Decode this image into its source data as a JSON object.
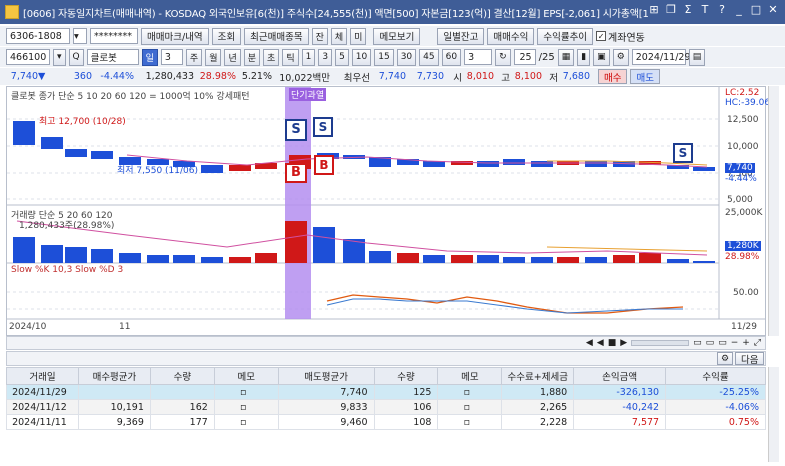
{
  "window": {
    "title": "[0606] 자동일지차트(매매내역) - KOSDAQ 외국인보유[6(천)] 주식수[24,555(천)] 액면[500] 자본금[123(억)] 결산[12월] EPS[-2,061] 시가총액[1"
  },
  "toolbar1": {
    "account": "6306-1808",
    "password": "********",
    "btn_trade_mark": "매매마크/내역",
    "btn_query": "조회",
    "btn_recent": "최근매매종목",
    "btn_jan": "잔",
    "btn_che": "체",
    "btn_mi": "미",
    "btn_memo": "메모보기",
    "btn_daily": "일별잔고",
    "btn_profit": "매매수익",
    "btn_trend": "수익률추이",
    "chk_link": "계좌연동"
  },
  "toolbar2": {
    "code": "466100",
    "name": "클로봇",
    "periods": [
      "일",
      "3",
      "주",
      "월",
      "년",
      "분",
      "초",
      "틱"
    ],
    "intervals": [
      "1",
      "3",
      "5",
      "10",
      "15",
      "30",
      "45",
      "60"
    ],
    "count_sel": "3",
    "page": "25",
    "total": "/25",
    "date": "2024/11/29"
  },
  "quote": {
    "price": "7,740",
    "arrow": "▼",
    "change": "360",
    "rate": "-4.44%",
    "volume": "1,280,433",
    "vol_rate": "28.98%",
    "turnover": "5.21%",
    "amount": "10,022백만",
    "priority": "최우선",
    "ask": "7,740",
    "bid": "7,730",
    "open_lbl": "시",
    "open": "8,010",
    "high_lbl": "고",
    "high": "8,100",
    "low_lbl": "저",
    "low": "7,680",
    "buy_btn": "매수",
    "sell_btn": "매도"
  },
  "chart": {
    "legend": "클로봇 종가 단순 5 10 20 60 120 = 1000억 10% 강세패턴",
    "highlight_label": "단기과열",
    "high_note": "최고 12,700 (10/28)",
    "low_note": "최저 7,550 (11/06)",
    "price_axis": [
      "12,500",
      "10,000",
      "7,500",
      "5,000"
    ],
    "lc": "LC:2.52",
    "hc": "HC:-39.06",
    "cur_price": "7,740",
    "cur_rate": "-4.44%",
    "vol_legend": "거래량 단순 5 20 60 120",
    "vol_value": "1,280,433주(28.98%)",
    "vol_axis": "25,000K",
    "vol_cur": "1,280K",
    "vol_rate": "28.98%",
    "slow_legend": "Slow %K 10,3 Slow %D 3",
    "slow_axis": "50.00",
    "date_left": "2024/10",
    "date_mid": "11",
    "date_right": "11/29",
    "marker_s": "S",
    "marker_b": "B"
  },
  "grid_btn": {
    "next": "다음"
  },
  "table": {
    "headers": [
      "거래일",
      "매수평균가",
      "수량",
      "메모",
      "매도평균가",
      "수량",
      "메모",
      "수수료+제세금",
      "손익금액",
      "수익률"
    ],
    "rows": [
      [
        "2024/11/29",
        "",
        "",
        "",
        "7,740",
        "125",
        "",
        "1,880",
        "-326,130",
        "-25.25%"
      ],
      [
        "2024/11/12",
        "10,191",
        "162",
        "",
        "9,833",
        "106",
        "",
        "2,265",
        "-40,242",
        "-4.06%"
      ],
      [
        "2024/11/11",
        "9,369",
        "177",
        "",
        "9,460",
        "108",
        "",
        "2,228",
        "7,577",
        "0.75%"
      ]
    ]
  }
}
